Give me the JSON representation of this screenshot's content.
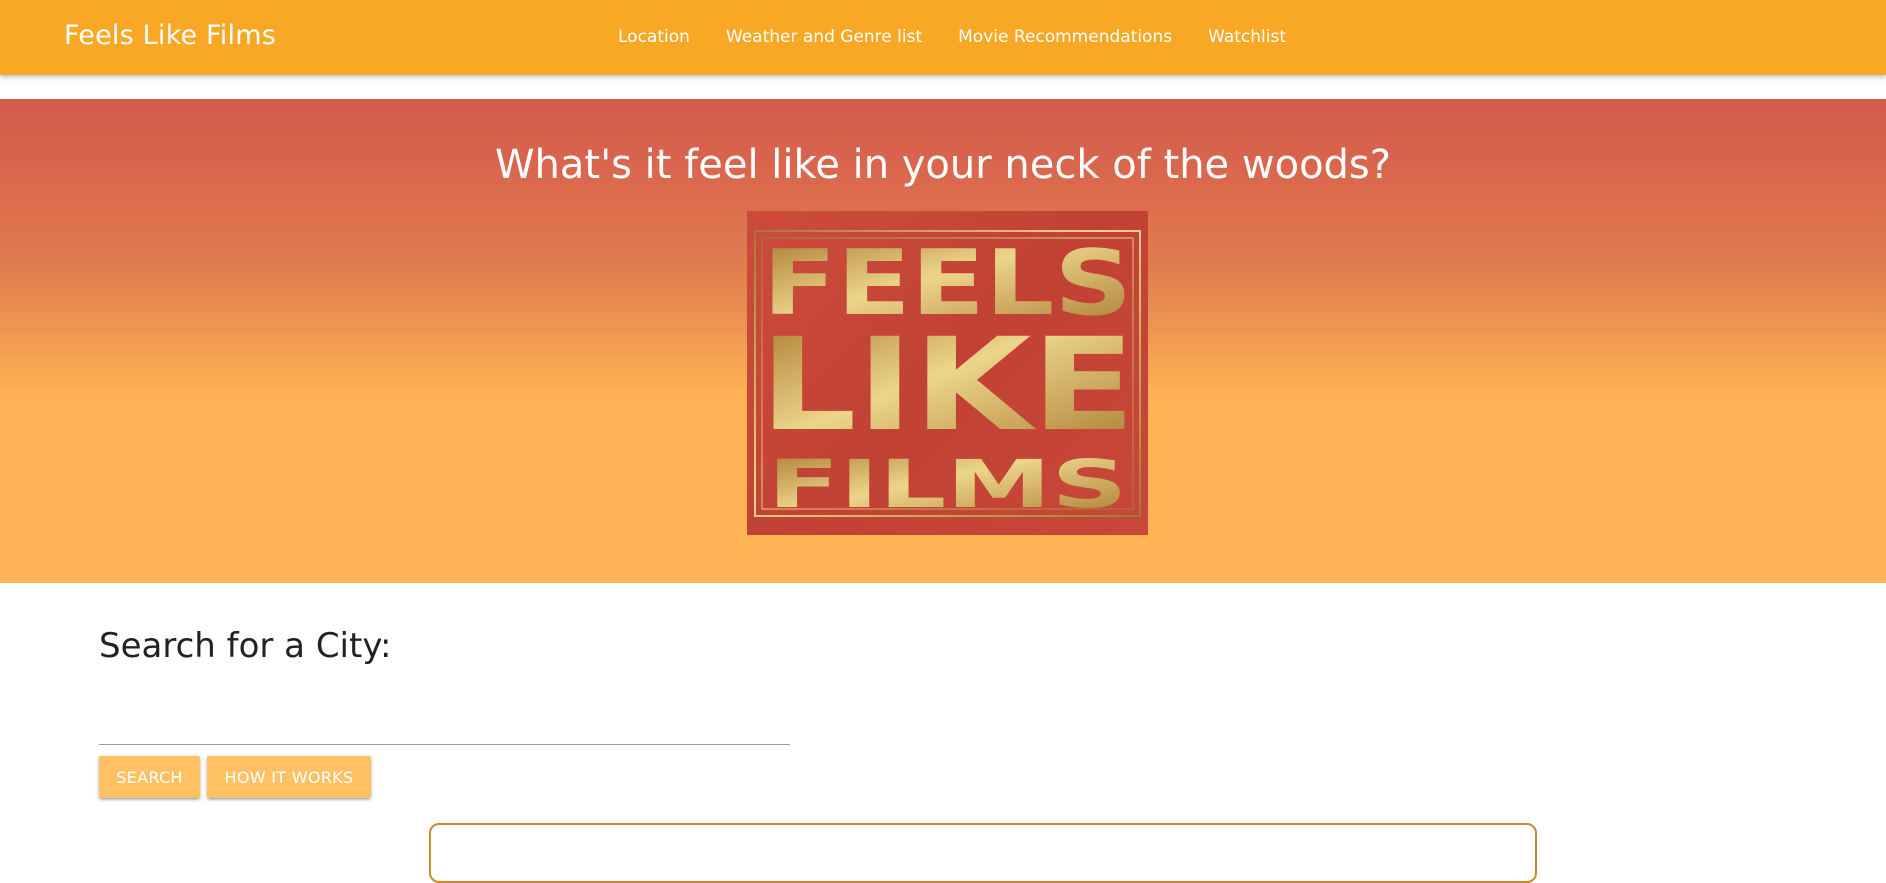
{
  "navbar": {
    "brand": "Feels Like Films",
    "links": [
      "Location",
      "Weather and Genre list",
      "Movie Recommendations",
      "Watchlist"
    ],
    "color": "#f9a825"
  },
  "hero": {
    "title": "What's it feel like in your neck of the woods?",
    "logo": {
      "lines": [
        "FEELS",
        "LIKE",
        "FILMS"
      ],
      "background": "#c54537",
      "letter_color": "#e3c16f"
    }
  },
  "search": {
    "heading": "Search for a City:",
    "input_value": "",
    "input_placeholder": "",
    "search_button": "Search",
    "how_button": "How it works"
  },
  "colors": {
    "accent": "#f9a825",
    "button": "#ffc163",
    "card_border": "#c98a2e"
  }
}
